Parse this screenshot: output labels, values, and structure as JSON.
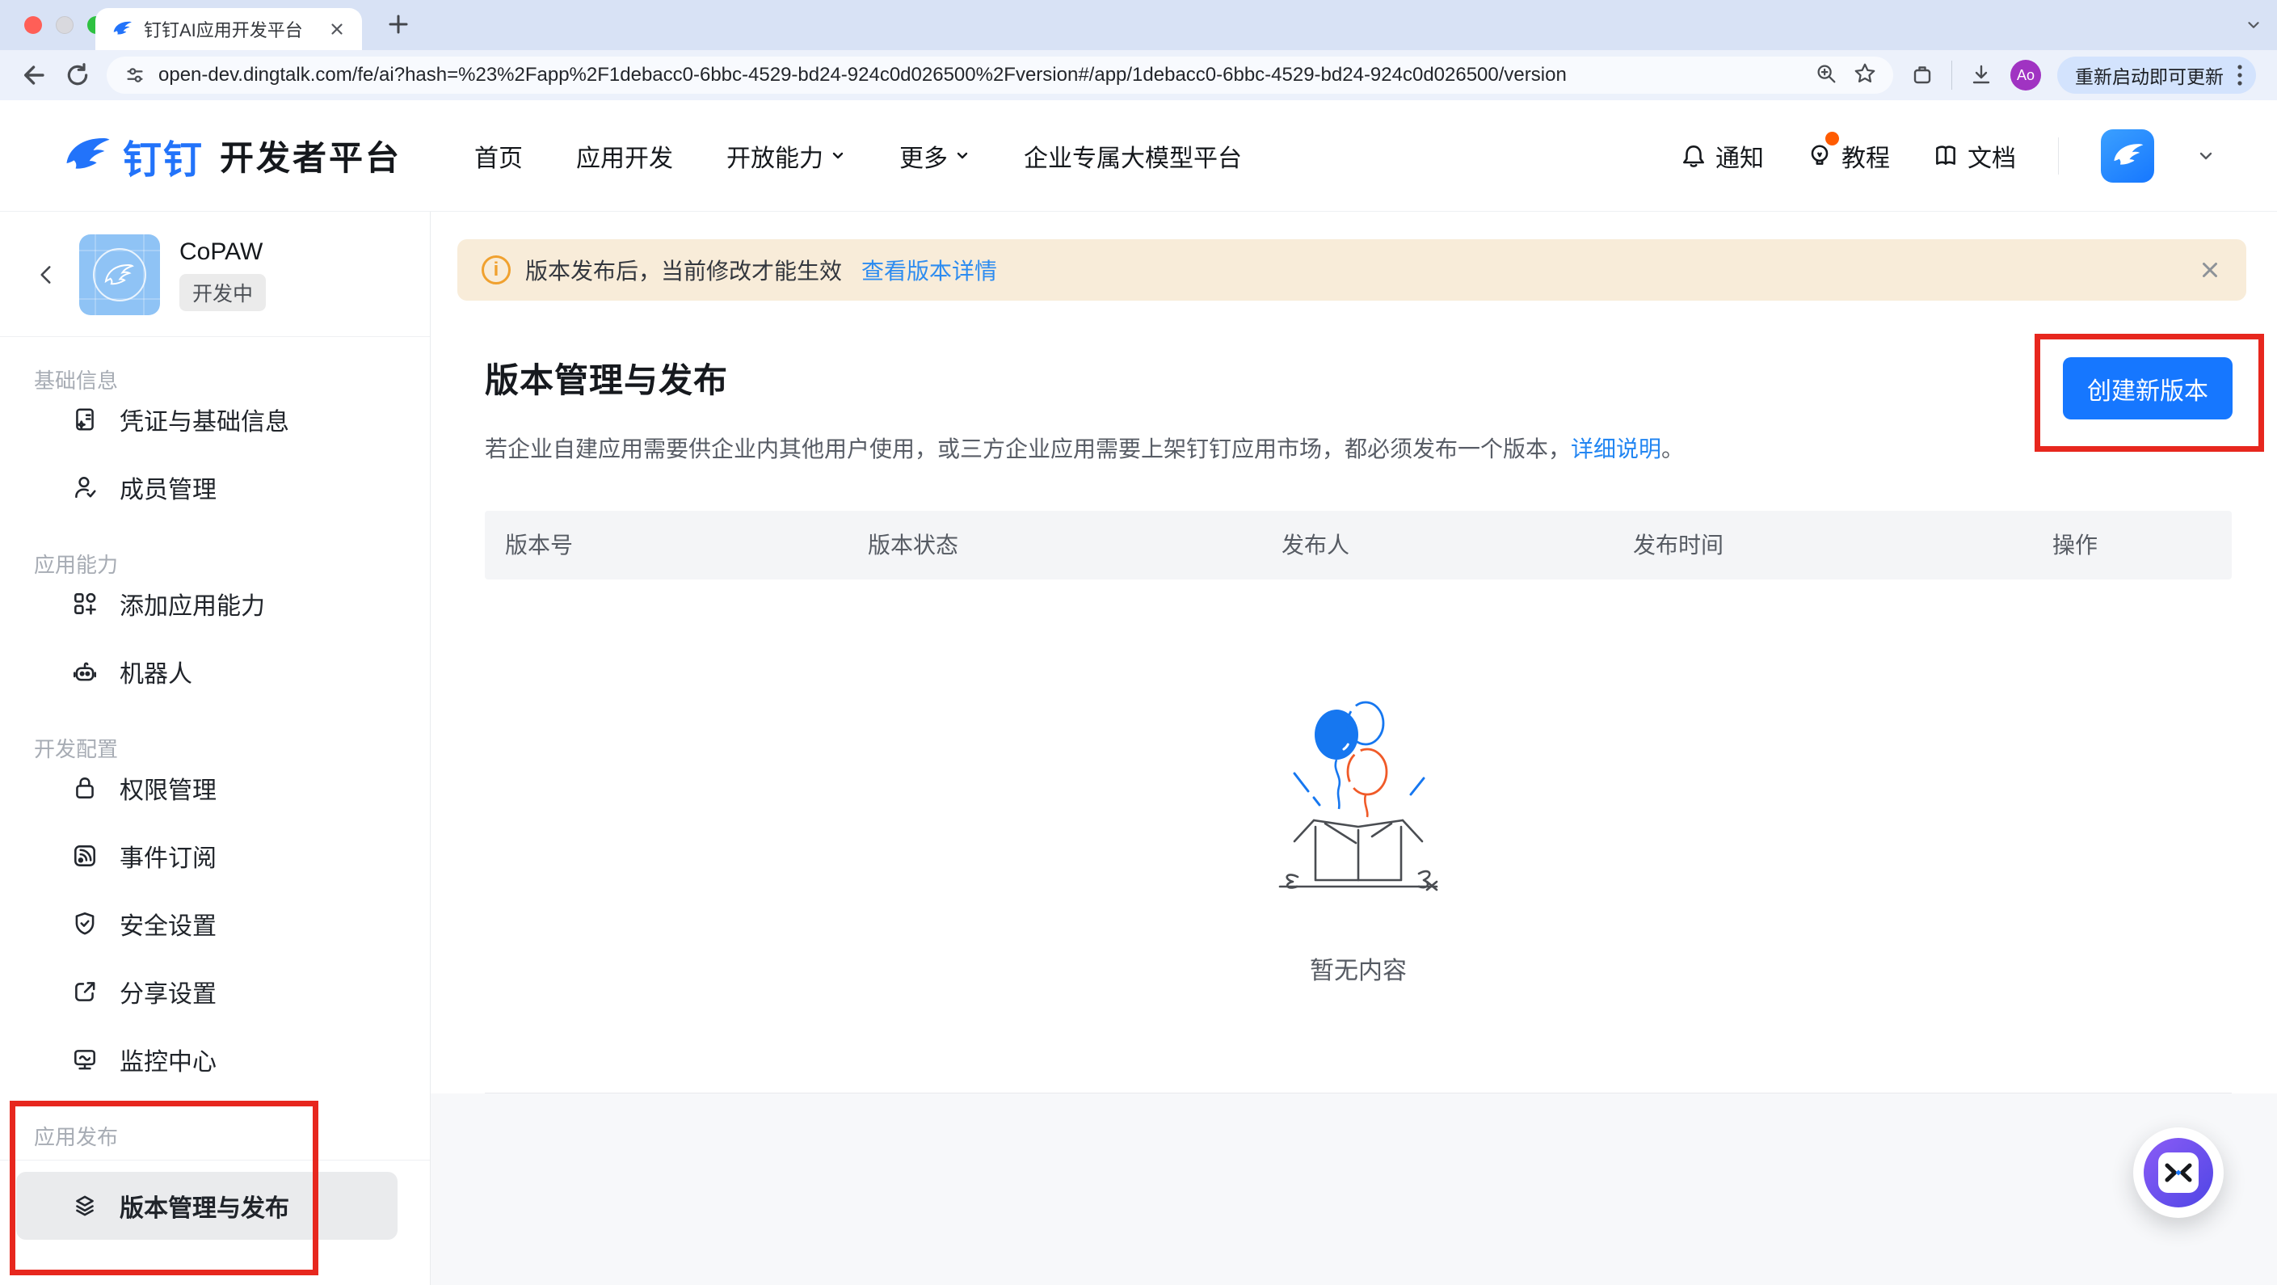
{
  "colors": {
    "accent": "#1677ff",
    "annotation_red": "#e7271e",
    "banner_bg": "#f8ecd9",
    "brand_blue": "#2273fa",
    "sidebar_active_bg": "#eaebed"
  },
  "browser": {
    "tab_title": "钉钉AI应用开发平台",
    "url": "open-dev.dingtalk.com/fe/ai?hash=%23%2Fapp%2F1debacc0-6bbc-4529-bd24-924c0d026500%2Fversion#/app/1debacc0-6bbc-4529-bd24-924c0d026500/version",
    "avatar": "Ao",
    "update_chip": "重新启动即可更新",
    "toolbar_icons": [
      "back",
      "reload",
      "tune",
      "zoom-in",
      "star",
      "extensions",
      "download"
    ]
  },
  "header": {
    "brand": "钉钉",
    "brand_suffix": "开发者平台",
    "nav": [
      {
        "label": "首页"
      },
      {
        "label": "应用开发"
      },
      {
        "label": "开放能力",
        "dropdown": true
      },
      {
        "label": "更多",
        "dropdown": true
      },
      {
        "label": "企业专属大模型平台"
      }
    ],
    "actions": [
      {
        "label": "通知",
        "icon": "bell-icon"
      },
      {
        "label": "教程",
        "icon": "bulb-icon",
        "badge": true
      },
      {
        "label": "文档",
        "icon": "book-icon"
      }
    ]
  },
  "sidebar": {
    "app_name": "CoPAW",
    "app_status": "开发中",
    "sections": [
      {
        "title": "基础信息",
        "items": [
          {
            "label": "凭证与基础信息",
            "icon": "id-card-icon"
          },
          {
            "label": "成员管理",
            "icon": "member-icon"
          }
        ]
      },
      {
        "title": "应用能力",
        "items": [
          {
            "label": "添加应用能力",
            "icon": "grid-plus-icon"
          },
          {
            "label": "机器人",
            "icon": "robot-icon"
          }
        ]
      },
      {
        "title": "开发配置",
        "items": [
          {
            "label": "权限管理",
            "icon": "lock-icon"
          },
          {
            "label": "事件订阅",
            "icon": "rss-icon"
          },
          {
            "label": "安全设置",
            "icon": "shield-icon"
          },
          {
            "label": "分享设置",
            "icon": "share-icon"
          },
          {
            "label": "监控中心",
            "icon": "monitor-icon"
          }
        ]
      },
      {
        "title": "应用发布",
        "items": [
          {
            "label": "版本管理与发布",
            "icon": "layers-icon",
            "active": true
          }
        ]
      }
    ]
  },
  "main": {
    "banner_text": "版本发布后，当前修改才能生效",
    "banner_link": "查看版本详情",
    "title": "版本管理与发布",
    "desc": "若企业自建应用需要供企业内其他用户使用，或三方企业应用需要上架钉钉应用市场，都必须发布一个版本，",
    "desc_link": "详细说明",
    "desc_suffix": "。",
    "create_button": "创建新版本",
    "columns": [
      "版本号",
      "版本状态",
      "发布人",
      "发布时间",
      "操作"
    ],
    "empty_text": "暂无内容"
  }
}
